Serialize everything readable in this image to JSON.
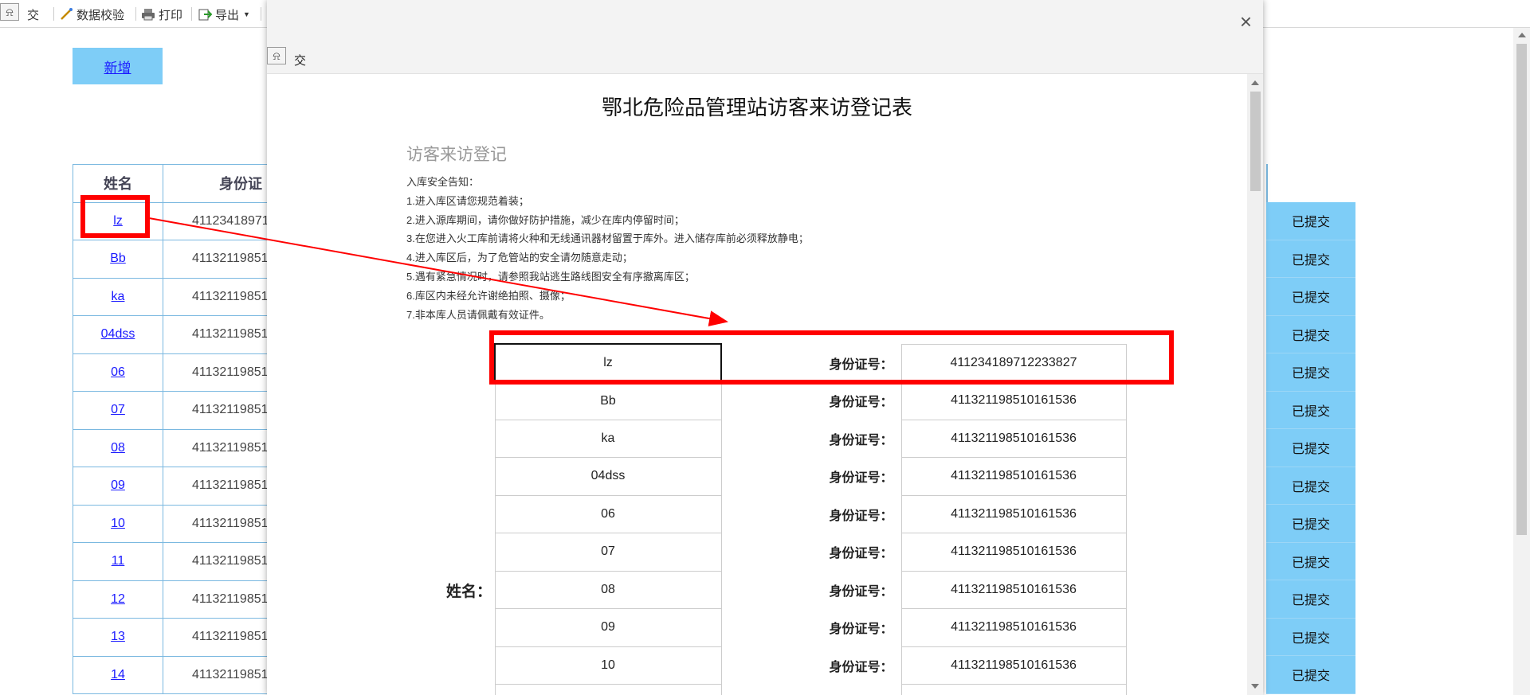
{
  "toolbar": {
    "submit_label": "交",
    "validate_label": "数据校验",
    "print_label": "打印",
    "export_label": "导出"
  },
  "page": {
    "add_button": "新增",
    "headers": {
      "name": "姓名",
      "id": "身份证"
    }
  },
  "rows": [
    {
      "name": "lz",
      "id": "41123418971",
      "status": "已提交"
    },
    {
      "name": "Bb",
      "id": "41132119851",
      "status": "已提交"
    },
    {
      "name": "ka",
      "id": "41132119851",
      "status": "已提交"
    },
    {
      "name": "04dss",
      "id": "41132119851",
      "status": "已提交"
    },
    {
      "name": "06",
      "id": "41132119851",
      "status": "已提交"
    },
    {
      "name": "07",
      "id": "41132119851",
      "status": "已提交"
    },
    {
      "name": "08",
      "id": "41132119851",
      "status": "已提交"
    },
    {
      "name": "09",
      "id": "41132119851",
      "status": "已提交"
    },
    {
      "name": "10",
      "id": "41132119851",
      "status": "已提交"
    },
    {
      "name": "11",
      "id": "41132119851",
      "status": "已提交"
    },
    {
      "name": "12",
      "id": "41132119851",
      "status": "已提交"
    },
    {
      "name": "13",
      "id": "41132119851",
      "status": "已提交"
    },
    {
      "name": "14",
      "id": "41132119851",
      "status": "已提交"
    }
  ],
  "modal": {
    "toolbar_submit_label": "交",
    "close_label": "×",
    "title": "鄂北危险品管理站访客来访登记表",
    "subtitle": "访客来访登记",
    "notice": [
      "入库安全告知：",
      "1.进入库区请您规范着装；",
      "2.进入源库期间，请你做好防护措施，减少在库内停留时间；",
      "3.在您进入火工库前请将火种和无线通讯器材留置于库外。进入储存库前必须释放静电；",
      "4.进入库区后，为了危管站的安全请勿随意走动；",
      "5.遇有紧急情况时，请参照我站逃生路线图安全有序撤离库区；",
      "6.库区内未经允许谢绝拍照、摄像；",
      "7.非本库人员请佩戴有效证件。"
    ],
    "name_label": "姓名：",
    "id_label": "身份证号：",
    "records": [
      {
        "name": "lz",
        "id": "411234189712233827"
      },
      {
        "name": "Bb",
        "id": "411321198510161536"
      },
      {
        "name": "ka",
        "id": "411321198510161536"
      },
      {
        "name": "04dss",
        "id": "411321198510161536"
      },
      {
        "name": "06",
        "id": "411321198510161536"
      },
      {
        "name": "07",
        "id": "411321198510161536"
      },
      {
        "name": "08",
        "id": "411321198510161536"
      },
      {
        "name": "09",
        "id": "411321198510161536"
      },
      {
        "name": "10",
        "id": "411321198510161536"
      },
      {
        "name": "",
        "id": ""
      }
    ]
  },
  "colors": {
    "accent": "#7ecdf7",
    "highlight": "#ff0000",
    "link": "#1a1aff"
  }
}
